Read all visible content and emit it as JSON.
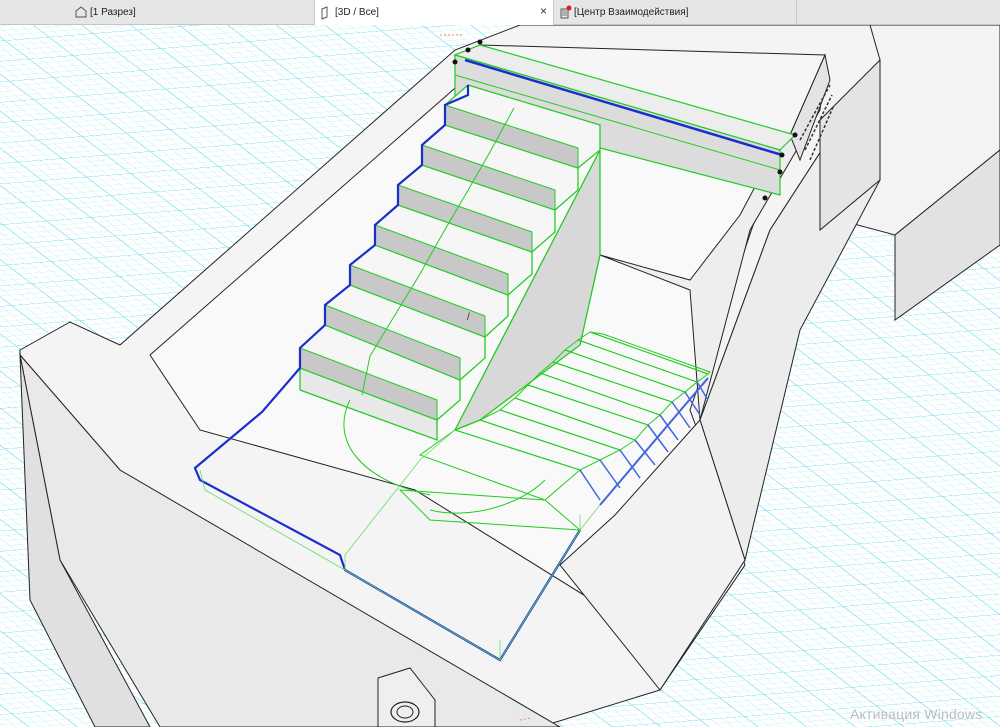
{
  "tabs": [
    {
      "label": "[1 Разрез]",
      "icon": "section-icon",
      "active": false
    },
    {
      "label": "[3D / Все]",
      "icon": "3d-window-icon",
      "active": true,
      "close_label": "×"
    },
    {
      "label": "[Центр Взаимодействия]",
      "icon": "collaboration-center-icon",
      "active": false
    }
  ],
  "viewport": {
    "view": "3D",
    "grid_color": "#4fd8e8",
    "wall_color": "#efefef",
    "selection_color": "#22cc22",
    "reference_line_color": "#1a2ecc"
  },
  "watermark": "Активация Windows",
  "cursor_glyph": "/"
}
